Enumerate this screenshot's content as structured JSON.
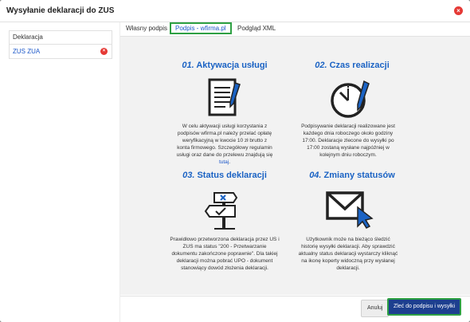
{
  "modal": {
    "title": "Wysyłanie deklaracji do ZUS",
    "close_symbol": "×"
  },
  "left_panel": {
    "header": "Deklaracja",
    "items": [
      {
        "label": "ZUS ZUA",
        "remove_symbol": "×"
      }
    ]
  },
  "tabs": [
    {
      "label": "Własny podpis",
      "active": false
    },
    {
      "label": "Podpis - wfirma.pl",
      "active": true
    },
    {
      "label": "Podgląd XML",
      "active": false
    }
  ],
  "sections": [
    {
      "num": "01.",
      "title": "Aktywacja usługi",
      "icon": "document-pen-icon",
      "text_before_link": "W celu aktywacji usługi korzystania z podpisów wfirma.pl należy przelać opłatę weryfikacyjną w kwocie 10 zł brutto z konta firmowego. Szczegółowy regulamin usługi oraz dane do przelewu znajdują się ",
      "link": "tutaj",
      "text_after_link": "."
    },
    {
      "num": "02.",
      "title": "Czas realizacji",
      "icon": "clock-pen-icon",
      "text": "Podpisywanie deklaracji realizowane jest każdego dnia roboczego około godziny 17:00. Deklaracje zlecone do wysyłki po 17:00 zostaną wysłane najpóźniej w kolejnym dniu roboczym."
    },
    {
      "num": "03.",
      "title": "Status deklaracji",
      "icon": "signpost-icon",
      "text": "Prawidłowo przetworzona deklaracja przez US i ZUS ma status \"200 - Przetwarzanie dokumentu zakończone poprawnie\". Dla takiej deklaracji można pobrać UPO - dokument stanowiący dowód złożenia deklaracji."
    },
    {
      "num": "04.",
      "title": "Zmiany statusów",
      "icon": "envelope-cursor-icon",
      "text": "Użytkownik może na bieżąco śledzić historię wysyłki deklaracji. Aby sprawdzić aktualny status deklaracji wystarczy kliknąć na ikonę koperty widoczną przy wysłanej deklaracji."
    }
  ],
  "footer": {
    "cancel_label": "Anuluj",
    "submit_label": "Zleć do podpisu i wysyłki"
  },
  "colors": {
    "accent": "#1b63c4",
    "primary_button": "#1d3f8f",
    "highlight": "#2ea043",
    "danger": "#e53935",
    "content_bg": "#f2f2f2"
  }
}
